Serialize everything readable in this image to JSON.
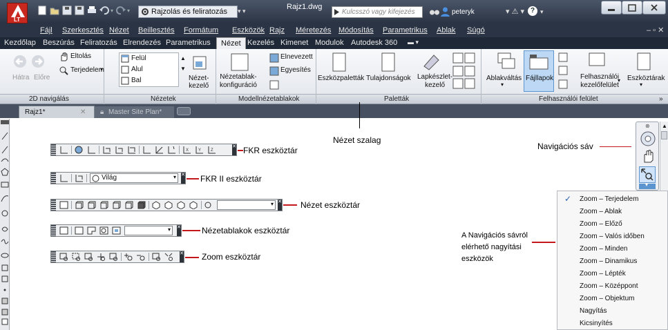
{
  "app": {
    "logo_text": "LT",
    "workspace": "Rajzolás és feliratozás",
    "filename": "Rajz1.dwg",
    "search_placeholder": "Kulcsszó vagy kifejezés",
    "user": "peteryk",
    "help": "?"
  },
  "menubar": [
    "Fájl",
    "Szerkesztés",
    "Nézet",
    "Beillesztés",
    "Formátum",
    "Eszközök",
    "Rajz",
    "Méretezés",
    "Módosítás",
    "Parametrikus",
    "Ablak",
    "Súgó"
  ],
  "ribbon_tabs": [
    "Kezdőlap",
    "Beszúrás",
    "Feliratozás",
    "Elrendezés",
    "Parametrikus",
    "Nézet",
    "Kezelés",
    "Kimenet",
    "Modulok",
    "Autodesk 360"
  ],
  "active_tab": "Nézet",
  "ribbon": {
    "nav2d": {
      "back": "Hátra",
      "forward": "Előre",
      "pan": "Eltolás",
      "extents": "Terjedelem",
      "title": "2D navigálás"
    },
    "views": {
      "items": [
        "Felül",
        "Alul",
        "Bal"
      ],
      "manager": "Nézet-\nkezelő",
      "title": "Nézetek"
    },
    "viewports": {
      "config": "Nézetablak-\nkonfiguráció",
      "named": "Elnevezett",
      "join": "Egyesítés",
      "title": "Modellnézetablakok"
    },
    "palettes": {
      "tool": "Eszközpaletták",
      "props": "Tulajdonságok",
      "sheetset": "Lapkészlet-\nkezelő",
      "title": "Paletták"
    },
    "ui": {
      "switch": "Ablakváltás",
      "filetabs": "Fájllapok",
      "userif": "Felhasználói\nkezelőfelület",
      "toolbars": "Eszköztárak",
      "title": "Felhasználói felület"
    }
  },
  "doc_tabs": [
    "Rajz1*",
    "Master Site Plan*"
  ],
  "annotations": {
    "ucs": "FKR eszköztár",
    "ucs2": "FKR II eszköztár",
    "ucs2_value": "Világ",
    "view": "Nézet eszköztár",
    "viewports": "Nézetablakok eszköztár",
    "zoom": "Zoom eszköztár",
    "ribbon": "Nézet szalag",
    "navbar": "Navigációs sáv",
    "navzoom": "A Navigációs sávról\nelérhető nagyítási\neszközök"
  },
  "zoom_menu": {
    "checked": "Zoom – Terjedelem",
    "items": [
      "Zoom – Terjedelem",
      "Zoom – Ablak",
      "Zoom – Előző",
      "Zoom – Valós időben",
      "Zoom – Minden",
      "Zoom – Dinamikus",
      "Zoom – Lépték",
      "Zoom – Középpont",
      "Zoom – Objektum",
      "Nagyítás",
      "Kicsinyítés"
    ]
  },
  "colors": {
    "accent": "#c4171b",
    "titlebar": "#2b3444",
    "ribbon": "#e6e9ee",
    "active_btn": "#bcd8f5"
  }
}
